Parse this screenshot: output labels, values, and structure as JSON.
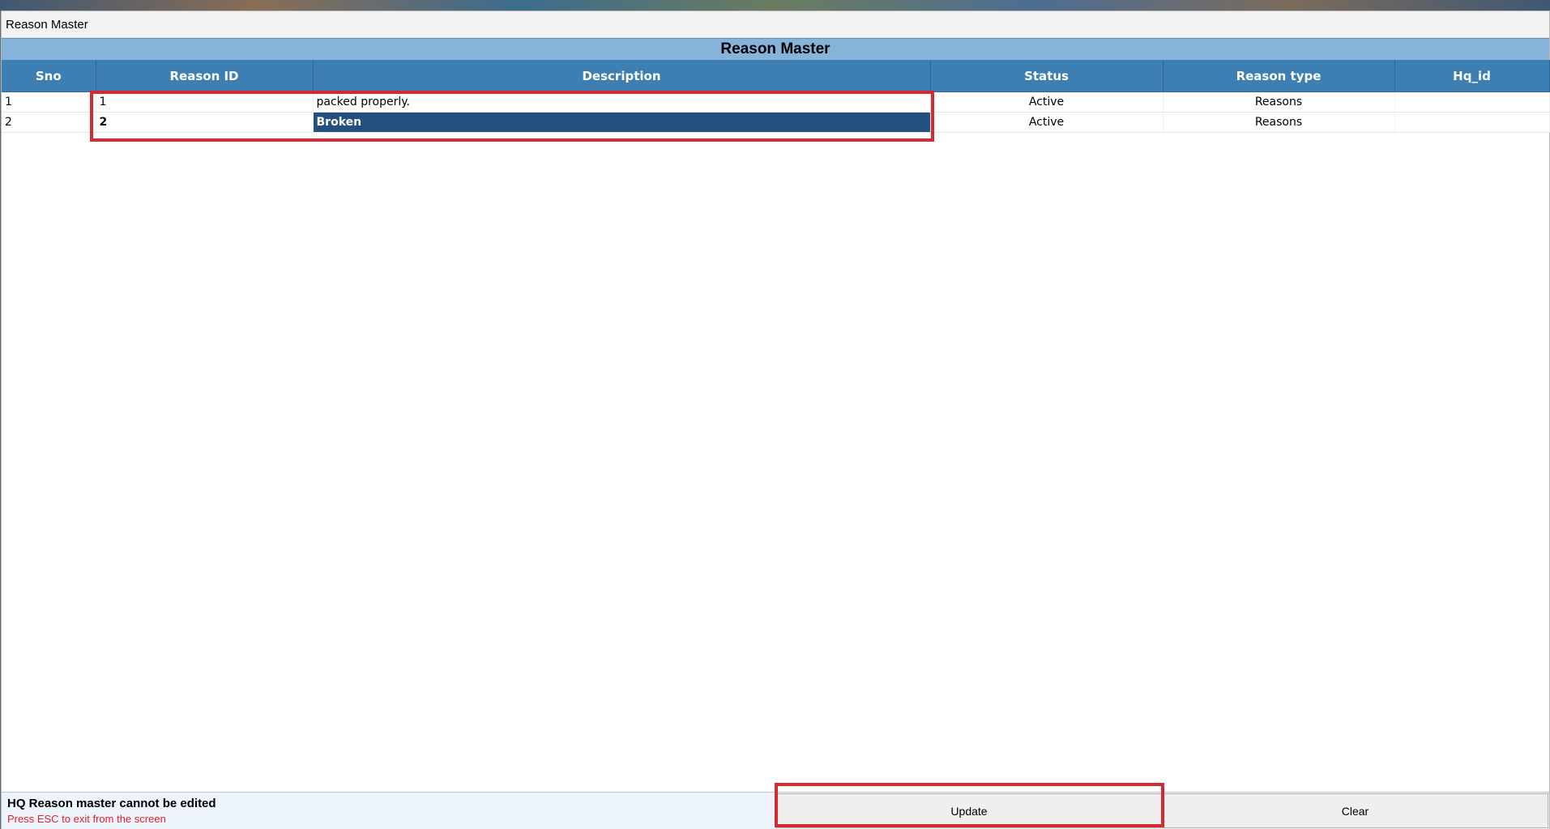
{
  "window": {
    "title": "Reason Master"
  },
  "header": {
    "title": "Reason Master"
  },
  "table": {
    "columns": [
      "Sno",
      "Reason ID",
      "Description",
      "Status",
      "Reason type",
      "Hq_id"
    ],
    "rows": [
      {
        "sno": "1",
        "reason_id": "1",
        "description": "packed properly.",
        "status": "Active",
        "reason_type": "Reasons",
        "hq_id": ""
      },
      {
        "sno": "2",
        "reason_id": "2",
        "description": "Broken",
        "status": "Active",
        "reason_type": "Reasons",
        "hq_id": ""
      }
    ],
    "selected_row": 2
  },
  "footer": {
    "message": "HQ Reason master cannot be edited",
    "hint": "Press ESC to exit from the screen",
    "update_label": "Update",
    "clear_label": "Clear"
  },
  "colors": {
    "header_bg": "#3e7fb3",
    "banner_bg": "#85b3da",
    "selection_bg": "#23507f",
    "highlight_border": "#d42a32",
    "hint_text": "#e0202b"
  }
}
